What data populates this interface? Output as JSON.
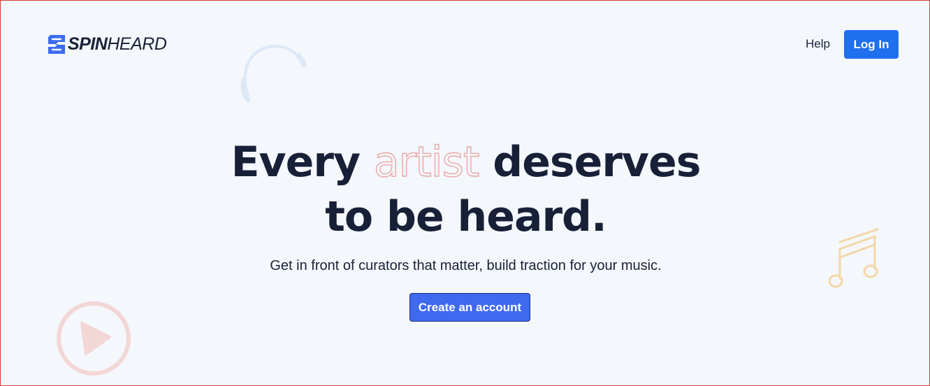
{
  "header": {
    "logo": {
      "part1": "SPIN",
      "part2": "HEARD",
      "icon": "spinheard-logo-icon"
    },
    "nav": {
      "help_label": "Help",
      "login_label": "Log In"
    }
  },
  "hero": {
    "title_before": "Every ",
    "title_accent": "artist",
    "title_after": " deserves",
    "title_line2": "to be heard.",
    "subtitle": "Get in front of curators that matter, build traction for your music.",
    "cta_label": "Create an account"
  },
  "decorations": {
    "headphones_icon": "headphones-icon",
    "note_icon": "music-note-icon",
    "play_icon": "play-icon"
  },
  "colors": {
    "background": "#f4f7fb",
    "text": "#1a2138",
    "login_button": "#1f6fef",
    "cta_button": "#3f6af0",
    "accent_outline": "#eba7a7",
    "headphones": "#dce8f7",
    "note": "#f2d7a6",
    "play": "#f3d6d6"
  }
}
